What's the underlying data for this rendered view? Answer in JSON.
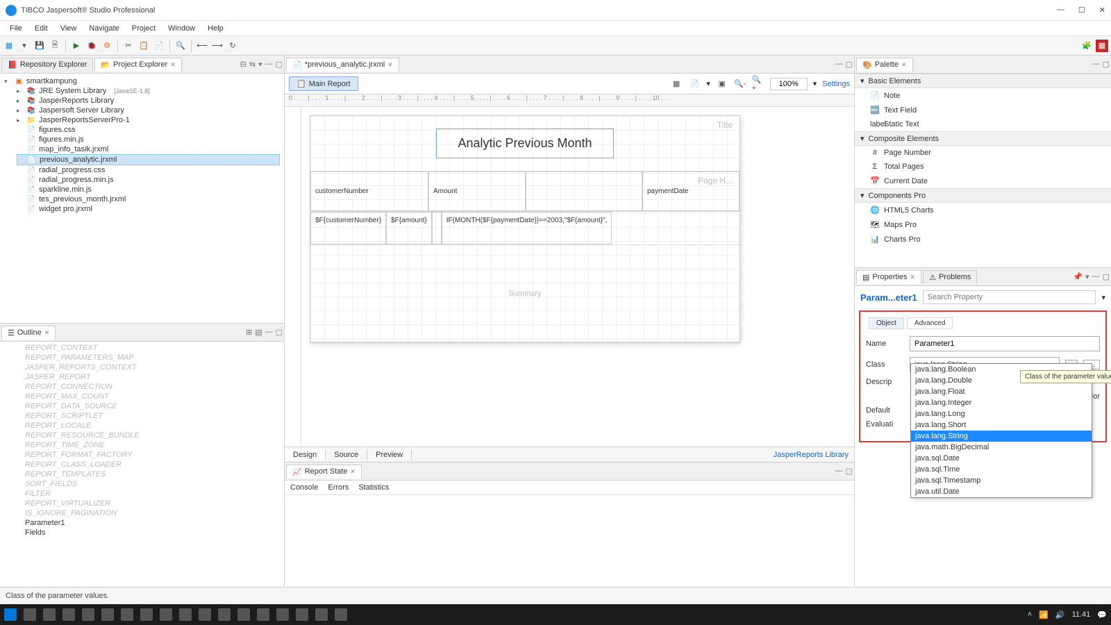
{
  "window": {
    "title": "TIBCO Jaspersoft® Studio Professional"
  },
  "menu": [
    "File",
    "Edit",
    "View",
    "Navigate",
    "Project",
    "Window",
    "Help"
  ],
  "left": {
    "repo_tab": "Repository Explorer",
    "proj_tab": "Project Explorer",
    "project_root": "smartkampung",
    "tree": {
      "jre": "JRE System Library",
      "jre_badge": "[JavaSE-1.8]",
      "jr_lib": "JasperReports Library",
      "js_server": "Jaspersoft Server Library",
      "jr_server_pro": "JasperReportsServerPro-1",
      "f1": "figures.css",
      "f2": "figures.min.js",
      "f3": "map_info_tasik.jrxml",
      "f4": "previous_analytic.jrxml",
      "f5": "radial_progress.css",
      "f6": "radial_progress.min.js",
      "f7": "sparkline.min.js",
      "f8": "tes_previous_month.jrxml",
      "f9": "widget pro.jrxml"
    },
    "outline_tab": "Outline",
    "outline": [
      "REPORT_CONTEXT",
      "REPORT_PARAMETERS_MAP",
      "JASPER_REPORTS_CONTEXT",
      "JASPER_REPORT",
      "REPORT_CONNECTION",
      "REPORT_MAX_COUNT",
      "REPORT_DATA_SOURCE",
      "REPORT_SCRIPTLET",
      "REPORT_LOCALE",
      "REPORT_RESOURCE_BUNDLE",
      "REPORT_TIME_ZONE",
      "REPORT_FORMAT_FACTORY",
      "REPORT_CLASS_LOADER",
      "REPORT_TEMPLATES",
      "SORT_FIELDS",
      "FILTER",
      "REPORT_VIRTUALIZER",
      "IS_IGNORE_PAGINATION"
    ],
    "outline_solid": "Parameter1",
    "outline_extra": "Fields"
  },
  "editor": {
    "file_tab": "*previous_analytic.jrxml",
    "main_report": "Main Report",
    "zoom": "100%",
    "settings": "Settings",
    "ruler": "0 . . . . | . . . . 1 . . . . | . . . . 2 . . . . | . . . . 3 . . . . | . . . . 4 . . . . | . . . . 5 . . . . | . . . . 6 . . . . | . . . . 7 . . . . | . . . . 8 . . . . | . . . . 9 . . . . | . . . . 10 . . .",
    "title_label": "Title",
    "title_text": "Analytic Previous Month",
    "ph_label": "Page H...",
    "ph": {
      "c1": "customerNumber",
      "c2": "Amount",
      "c4": "paymentDate"
    },
    "det": {
      "c1": "$F{customerNumber}",
      "c2": "$F{amount}",
      "c4": "IF(MONTH($F{paymentDate})==2003,\"$F{amount}\","
    },
    "summary": "Summary",
    "footer": {
      "design": "Design",
      "source": "Source",
      "preview": "Preview",
      "lib": "JasperReports Library"
    },
    "report_state": "Report State",
    "rs_tabs": [
      "Console",
      "Errors",
      "Statistics"
    ]
  },
  "palette": {
    "tab": "Palette",
    "sections": {
      "basic": "Basic Elements",
      "composite": "Composite Elements",
      "components": "Components Pro"
    },
    "basic_items": [
      {
        "label": "Note",
        "icon": "📄"
      },
      {
        "label": "Text Field",
        "icon": "🔤"
      },
      {
        "label": "Static Text",
        "icon": "label"
      }
    ],
    "composite_items": [
      {
        "label": "Page Number",
        "icon": "#"
      },
      {
        "label": "Total Pages",
        "icon": "Σ"
      },
      {
        "label": "Current Date",
        "icon": "📅"
      }
    ],
    "component_items": [
      {
        "label": "HTML5 Charts",
        "icon": "🌐"
      },
      {
        "label": "Maps Pro",
        "icon": "🗺"
      },
      {
        "label": "Charts Pro",
        "icon": "📊"
      }
    ]
  },
  "props": {
    "tab_properties": "Properties",
    "tab_problems": "Problems",
    "title": "Param...eter1",
    "search_ph": "Search Property",
    "tab_object": "Object",
    "tab_advanced": "Advanced",
    "name_label": "Name",
    "name_val": "Parameter1",
    "class_label": "Class",
    "class_val": "java.lang.String",
    "desc_label": "Descrip",
    "isfor_label": "Is For",
    "default_label": "Default",
    "eval_label": "Evaluati",
    "tooltip": "Class of the parameter values.",
    "options": [
      "java.lang.Boolean",
      "java.lang.Double",
      "java.lang.Float",
      "java.lang.Integer",
      "java.lang.Long",
      "java.lang.Short",
      "java.lang.String",
      "java.math.BigDecimal",
      "java.sql.Date",
      "java.sql.Time",
      "java.sql.Timestamp",
      "java.util.Date"
    ],
    "selected_index": 6
  },
  "status": "Class of the parameter values.",
  "tray": {
    "time": "11.41"
  }
}
